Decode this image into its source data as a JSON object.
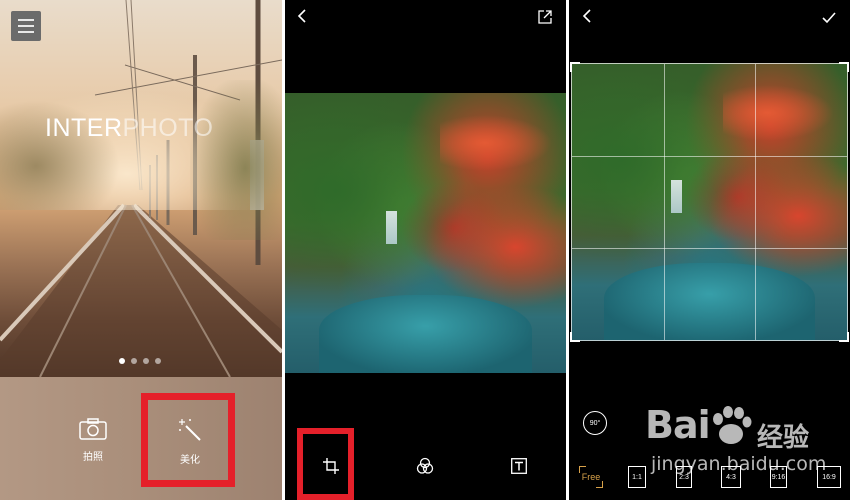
{
  "panel_launch": {
    "brand_part1": "INTER",
    "brand_part2": "PHOTO",
    "carousel_page": 1,
    "carousel_pages": 4,
    "camera_label": "拍照",
    "beautify_label": "美化",
    "highlight_color": "#e5202a"
  },
  "panel_editor": {
    "tools": [
      "crop-icon",
      "filter-icon",
      "text-icon"
    ]
  },
  "panel_crop": {
    "rotate_label": "90°",
    "ratios": [
      "Free",
      "1:1",
      "2:3",
      "4:3",
      "9:16",
      "16:9"
    ],
    "selected_ratio": "Free",
    "accent_color": "#d8a24a"
  },
  "watermark": {
    "logo": "Bai",
    "logo_suffix": "经验",
    "url": "jingyan.baidu.com"
  }
}
